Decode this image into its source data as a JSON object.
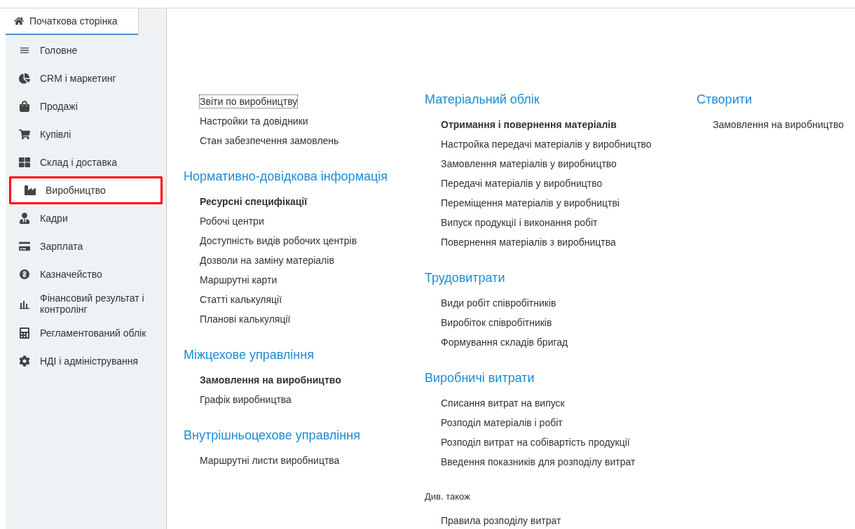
{
  "home_tab": {
    "label": "Початкова сторінка",
    "selected": true
  },
  "sidebar": {
    "items": [
      {
        "label": "Головне",
        "selected": false
      },
      {
        "label": "CRM і маркетинг",
        "selected": false
      },
      {
        "label": "Продажі",
        "selected": false
      },
      {
        "label": "Купівлі",
        "selected": false
      },
      {
        "label": "Склад і доставка",
        "selected": false
      },
      {
        "label": "Виробництво",
        "selected": true
      },
      {
        "label": "Кадри",
        "selected": false
      },
      {
        "label": "Зарплата",
        "selected": false
      },
      {
        "label": "Казначейство",
        "selected": false
      },
      {
        "label": "Фінансовий результат і контролінг",
        "selected": false
      },
      {
        "label": "Регламентований облік",
        "selected": false
      },
      {
        "label": "НДІ і адміністрування",
        "selected": false
      }
    ]
  },
  "columns": [
    {
      "sections": [
        {
          "items": [
            {
              "label": "Звіти по виробництву",
              "bold": false,
              "focused": true
            },
            {
              "label": "Настройки та довідники",
              "bold": false,
              "focused": false
            },
            {
              "label": "Стан забезпечення замовлень",
              "bold": false,
              "focused": false
            }
          ]
        },
        {
          "title": "Нормативно-довідкова інформація",
          "kind": "heading",
          "items": [
            {
              "label": "Ресурсні специфікації",
              "bold": true,
              "focused": false
            },
            {
              "label": "Робочі центри",
              "bold": false,
              "focused": false
            },
            {
              "label": "Доступність видів робочих центрів",
              "bold": false,
              "focused": false
            },
            {
              "label": "Дозволи на заміну матеріалів",
              "bold": false,
              "focused": false
            },
            {
              "label": "Маршрутні карти",
              "bold": false,
              "focused": false
            },
            {
              "label": "Статті калькуляції",
              "bold": false,
              "focused": false
            },
            {
              "label": "Планові калькуляції",
              "bold": false,
              "focused": false
            }
          ]
        },
        {
          "title": "Міжцехове управління",
          "kind": "heading",
          "items": [
            {
              "label": "Замовлення на виробництво",
              "bold": true,
              "focused": false
            },
            {
              "label": "Графік виробництва",
              "bold": false,
              "focused": false
            }
          ]
        },
        {
          "title": "Внутрішньоцехове управління",
          "kind": "heading",
          "items": [
            {
              "label": "Маршрутні листи виробництва",
              "bold": false,
              "focused": false
            }
          ]
        }
      ]
    },
    {
      "sections": [
        {
          "title": "Матеріальний облік",
          "kind": "heading",
          "items": [
            {
              "label": "Отримання і повернення матеріалів",
              "bold": true,
              "focused": false
            },
            {
              "label": "Настройка передачі матеріалів у виробництво",
              "bold": false,
              "focused": false
            },
            {
              "label": "Замовлення матеріалів у виробництво",
              "bold": false,
              "focused": false
            },
            {
              "label": "Передачі матеріалів у виробництво",
              "bold": false,
              "focused": false
            },
            {
              "label": "Переміщення матеріалів у виробництві",
              "bold": false,
              "focused": false
            },
            {
              "label": "Випуск продукції і виконання робіт",
              "bold": false,
              "focused": false
            },
            {
              "label": "Повернення матеріалів з виробництва",
              "bold": false,
              "focused": false
            }
          ]
        },
        {
          "title": "Трудовитрати",
          "kind": "heading",
          "items": [
            {
              "label": "Види робіт співробітників",
              "bold": false,
              "focused": false
            },
            {
              "label": "Виробіток співробітників",
              "bold": false,
              "focused": false
            },
            {
              "label": "Формування складів бригад",
              "bold": false,
              "focused": false
            }
          ]
        },
        {
          "title": "Виробничі витрати",
          "kind": "heading",
          "items": [
            {
              "label": "Списання витрат на випуск",
              "bold": false,
              "focused": false
            },
            {
              "label": "Розподіл матеріалів і робіт",
              "bold": false,
              "focused": false
            },
            {
              "label": "Розподіл витрат на собівартість продукції",
              "bold": false,
              "focused": false
            },
            {
              "label": "Введення показників для розподілу витрат",
              "bold": false,
              "focused": false
            }
          ]
        },
        {
          "title": "Див. також",
          "kind": "note",
          "items": [
            {
              "label": "Правила розподілу витрат",
              "bold": false,
              "focused": false
            }
          ]
        }
      ]
    },
    {
      "sections": [
        {
          "title": "Створити",
          "kind": "heading",
          "items": [
            {
              "label": "Замовлення на виробництво",
              "bold": false,
              "focused": false
            }
          ]
        }
      ]
    }
  ]
}
